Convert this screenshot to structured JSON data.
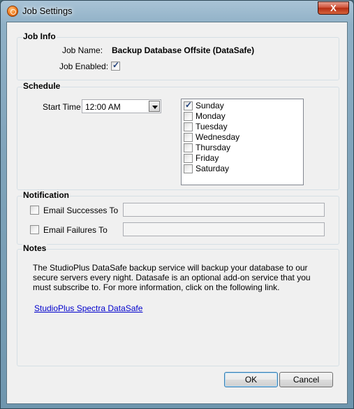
{
  "window": {
    "title": "Job Settings",
    "close_glyph": "X",
    "icon": "app-logo-icon"
  },
  "job_info": {
    "section_title": "Job Info",
    "job_name_label": "Job Name:",
    "job_name_value": "Backup Database Offsite (DataSafe)",
    "job_enabled_label": "Job Enabled:",
    "job_enabled_checked": true
  },
  "schedule": {
    "section_title": "Schedule",
    "start_time_label": "Start Time",
    "start_time_value": "12:00 AM",
    "days": [
      {
        "label": "Sunday",
        "checked": true
      },
      {
        "label": "Monday",
        "checked": false
      },
      {
        "label": "Tuesday",
        "checked": false
      },
      {
        "label": "Wednesday",
        "checked": false
      },
      {
        "label": "Thursday",
        "checked": false
      },
      {
        "label": "Friday",
        "checked": false
      },
      {
        "label": "Saturday",
        "checked": false
      }
    ]
  },
  "notification": {
    "section_title": "Notification",
    "email_successes_label": "Email Successes To",
    "email_successes_value": "",
    "email_failures_label": "Email Failures To",
    "email_failures_value": ""
  },
  "notes": {
    "section_title": "Notes",
    "lines": [
      "The StudioPlus DataSafe backup service will backup your database to our",
      "secure servers every night.  Datasafe is an optional add-on service that you",
      "must subscribe to.  For more information, click on the following link."
    ],
    "link_text": "StudioPlus Spectra DataSafe"
  },
  "buttons": {
    "ok_label": "OK",
    "cancel_label": "Cancel"
  }
}
